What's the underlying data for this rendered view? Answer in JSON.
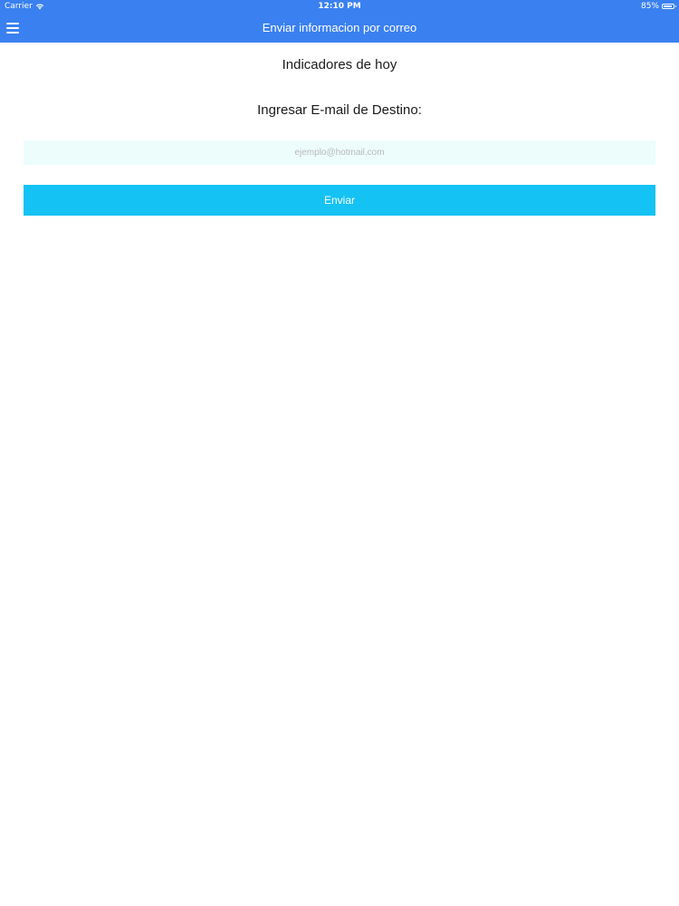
{
  "status_bar": {
    "carrier": "Carrier",
    "time": "12:10 PM",
    "battery": "85%"
  },
  "navbar": {
    "title": "Enviar informacion por correo",
    "menu_icon": "hamburger-menu-icon"
  },
  "main": {
    "heading": "Indicadores de hoy",
    "email_label": "Ingresar E-mail de Destino:",
    "email_input": {
      "value": "",
      "placeholder": "ejemplo@hotmail.com"
    },
    "send_label": "Enviar"
  },
  "colors": {
    "header_bg": "#3a80f0",
    "button_bg": "#14c2f3",
    "input_bg": "#ecfdfc"
  }
}
